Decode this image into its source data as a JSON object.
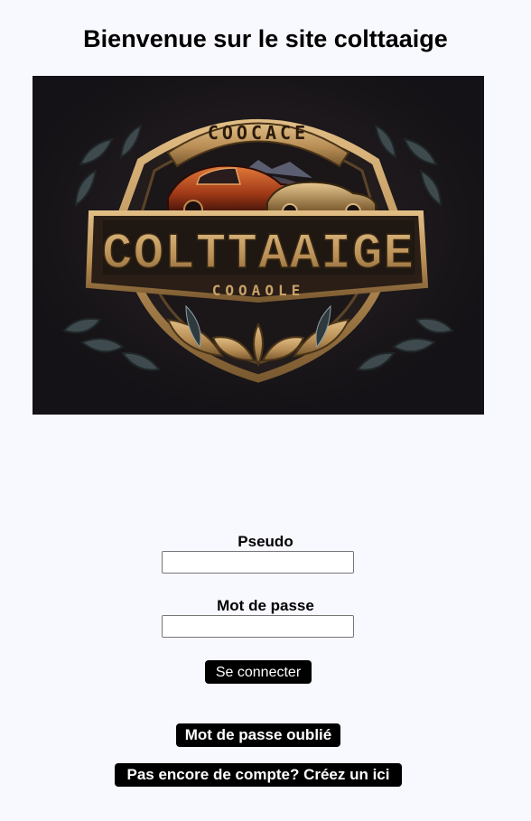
{
  "page": {
    "title": "Bienvenue sur le site colttaaige"
  },
  "logo": {
    "top_text": "COOCACE",
    "main_text": "COLTTAAIGE",
    "bottom_text": "COOAOLE",
    "icon": "vintage-car-emblem",
    "colors": {
      "background": "#141216",
      "gold": "#c9a26a",
      "dark_gold": "#8a6a3e",
      "car_red": "#a8401c"
    }
  },
  "form": {
    "pseudo_label": "Pseudo",
    "pseudo_value": "",
    "password_label": "Mot de passe",
    "password_value": "",
    "login_button": "Se connecter"
  },
  "links": {
    "forgot_password": "Mot de passe oublié",
    "create_account": "Pas encore de compte? Créez un ici"
  },
  "colors": {
    "page_background": "#f8f8ff",
    "button_background": "#000000",
    "button_text": "#ffffff"
  }
}
